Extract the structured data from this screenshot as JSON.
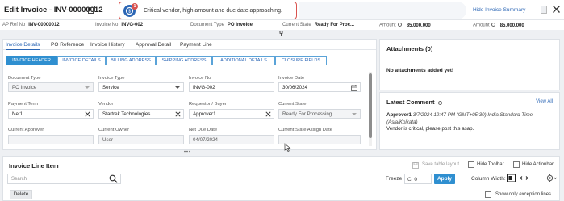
{
  "header": {
    "title": "Edit Invoice - INV-00000012",
    "alert_count": "1",
    "alert_text": "Critical vendor, high amount and due date approaching.",
    "hide_summary": "Hide Invoice Summary"
  },
  "summary": {
    "ap_ref": {
      "label": "AP Ref No",
      "value": "INV-00000012"
    },
    "invoice_no": {
      "label": "Invoice No",
      "value": "INVG-002"
    },
    "doc_type": {
      "label": "Document Type",
      "value": "PO Invoice"
    },
    "current_state": {
      "label": "Current State",
      "value": "Ready For Proc..."
    },
    "amount1": {
      "label": "Amount",
      "value": "85,000.000"
    },
    "amount2": {
      "label": "Amount",
      "value": "85,000.000"
    }
  },
  "tabs_primary": [
    "Invoice Details",
    "PO Reference",
    "Invoice History",
    "Approval Detail",
    "Payment Line"
  ],
  "tabs_secondary": [
    "INVOICE HEADER",
    "INVOICE DETAILS",
    "BILLING ADDRESS",
    "SHIPPING ADDRESS",
    "ADDITIONAL DETAILS",
    "CLOSURE FIELDS"
  ],
  "form": {
    "doc_type": {
      "label": "Document Type",
      "value": "PO Invoice"
    },
    "invoice_type": {
      "label": "Invoice Type",
      "value": "Service"
    },
    "invoice_no": {
      "label": "Invoice No",
      "value": "INVG-002"
    },
    "invoice_date": {
      "label": "Invoice Date",
      "value": "30/06/2024"
    },
    "payment_term": {
      "label": "Payment Term",
      "value": "Net1"
    },
    "vendor": {
      "label": "Vendor",
      "value": "Startrek Technologies"
    },
    "requestor": {
      "label": "Requestor / Buyer",
      "value": "Approver1"
    },
    "current_state": {
      "label": "Current State",
      "value": "Ready For Processing"
    },
    "current_approver": {
      "label": "Current Approver",
      "value": ""
    },
    "current_owner": {
      "label": "Current Owner",
      "value": "User"
    },
    "net_due_date": {
      "label": "Net Due Date",
      "value": "04/07/2024"
    },
    "state_assign_date": {
      "label": "Current State Assign Date",
      "value": ""
    }
  },
  "attachments": {
    "title": "Attachments (0)",
    "empty": "No attachments added yet!"
  },
  "comment": {
    "title": "Latest Comment",
    "view_all": "View All",
    "author": "Approver1",
    "timestamp": "3/7/2024 12:47 PM (GMT+05:30) India Standard Time (Asia/Kolkata)",
    "body": "Vendor is critical, please post this asap."
  },
  "line_items": {
    "title": "Invoice Line Item",
    "save_layout": "Save table layout",
    "hide_toolbar": "Hide Toolbar",
    "hide_actionbar": "Hide Actionbar",
    "search_placeholder": "Search",
    "freeze_label": "Freeze",
    "freeze_value": "0",
    "apply": "Apply",
    "column_width": "Column Width:",
    "delete": "Delete",
    "show_exceptions": "Show only exception lines"
  },
  "colors": {
    "accent": "#2b66b5",
    "button": "#2f8fd0",
    "alert_border": "#d9534f"
  }
}
